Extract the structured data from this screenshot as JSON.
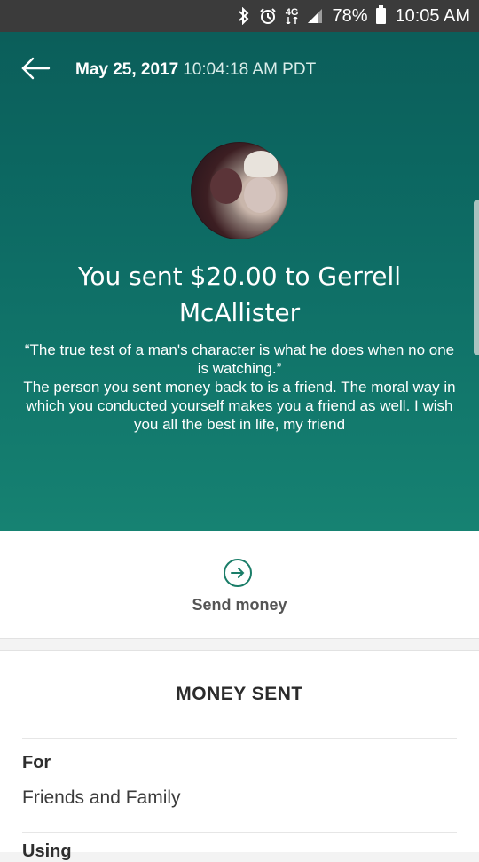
{
  "status_bar": {
    "icons": [
      "bluetooth-icon",
      "alarm-icon",
      "lte-icon",
      "signal-icon",
      "battery-icon"
    ],
    "network": "4G",
    "battery": "78%",
    "time": "10:05 AM"
  },
  "header": {
    "date": "May 25, 2017",
    "time": "10:04:18 AM PDT",
    "title": "You sent $20.00 to Gerrell McAllister",
    "note": "“The true test of a man's character is what he does when no one is watching.”\nThe person you sent money back to is a friend.  The moral way in which you conducted yourself makes you a friend as well.  I wish you all the best in life, my friend",
    "bg_color": "#0d6b64"
  },
  "action": {
    "send_label": "Send money",
    "accent": "#1a7d68"
  },
  "details": {
    "section_title": "MONEY SENT",
    "for_label": "For",
    "for_value": "Friends and Family",
    "next_label": "Using"
  }
}
